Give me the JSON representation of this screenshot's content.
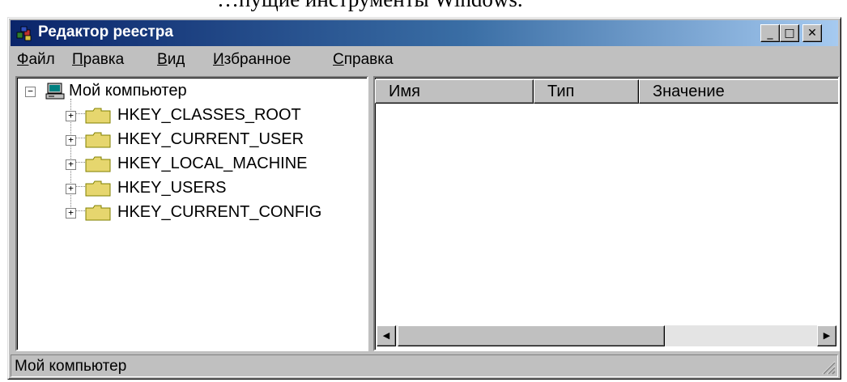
{
  "background_text": "…пущие инструменты Windows.",
  "window": {
    "title": "Редактор реестра",
    "buttons": {
      "minimize": "_",
      "maximize": "□",
      "close": "✕"
    }
  },
  "menu": [
    {
      "hotkey": "Ф",
      "rest": "айл"
    },
    {
      "hotkey": "П",
      "rest": "равка"
    },
    {
      "hotkey": "В",
      "rest": "ид"
    },
    {
      "hotkey": "И",
      "rest": "збранное"
    },
    {
      "hotkey": "С",
      "rest": "правка"
    }
  ],
  "tree": {
    "root": {
      "label": "Мой компьютер",
      "expander": "−",
      "icon": "computer-icon"
    },
    "children": [
      {
        "label": "HKEY_CLASSES_ROOT",
        "expander": "+",
        "icon": "folder-icon"
      },
      {
        "label": "HKEY_CURRENT_USER",
        "expander": "+",
        "icon": "folder-icon"
      },
      {
        "label": "HKEY_LOCAL_MACHINE",
        "expander": "+",
        "icon": "folder-icon"
      },
      {
        "label": "HKEY_USERS",
        "expander": "+",
        "icon": "folder-icon"
      },
      {
        "label": "HKEY_CURRENT_CONFIG",
        "expander": "+",
        "icon": "folder-icon"
      }
    ]
  },
  "list": {
    "columns": [
      {
        "label": "Имя"
      },
      {
        "label": "Тип"
      },
      {
        "label": "Значение"
      }
    ],
    "rows": []
  },
  "scrollbar": {
    "left_arrow": "◀",
    "right_arrow": "▶"
  },
  "status": {
    "text": "Мой компьютер"
  },
  "colors": {
    "title_start": "#0a246a",
    "title_end": "#a6caf0",
    "face": "#c0c0c0",
    "folder": "#e6d66e"
  }
}
